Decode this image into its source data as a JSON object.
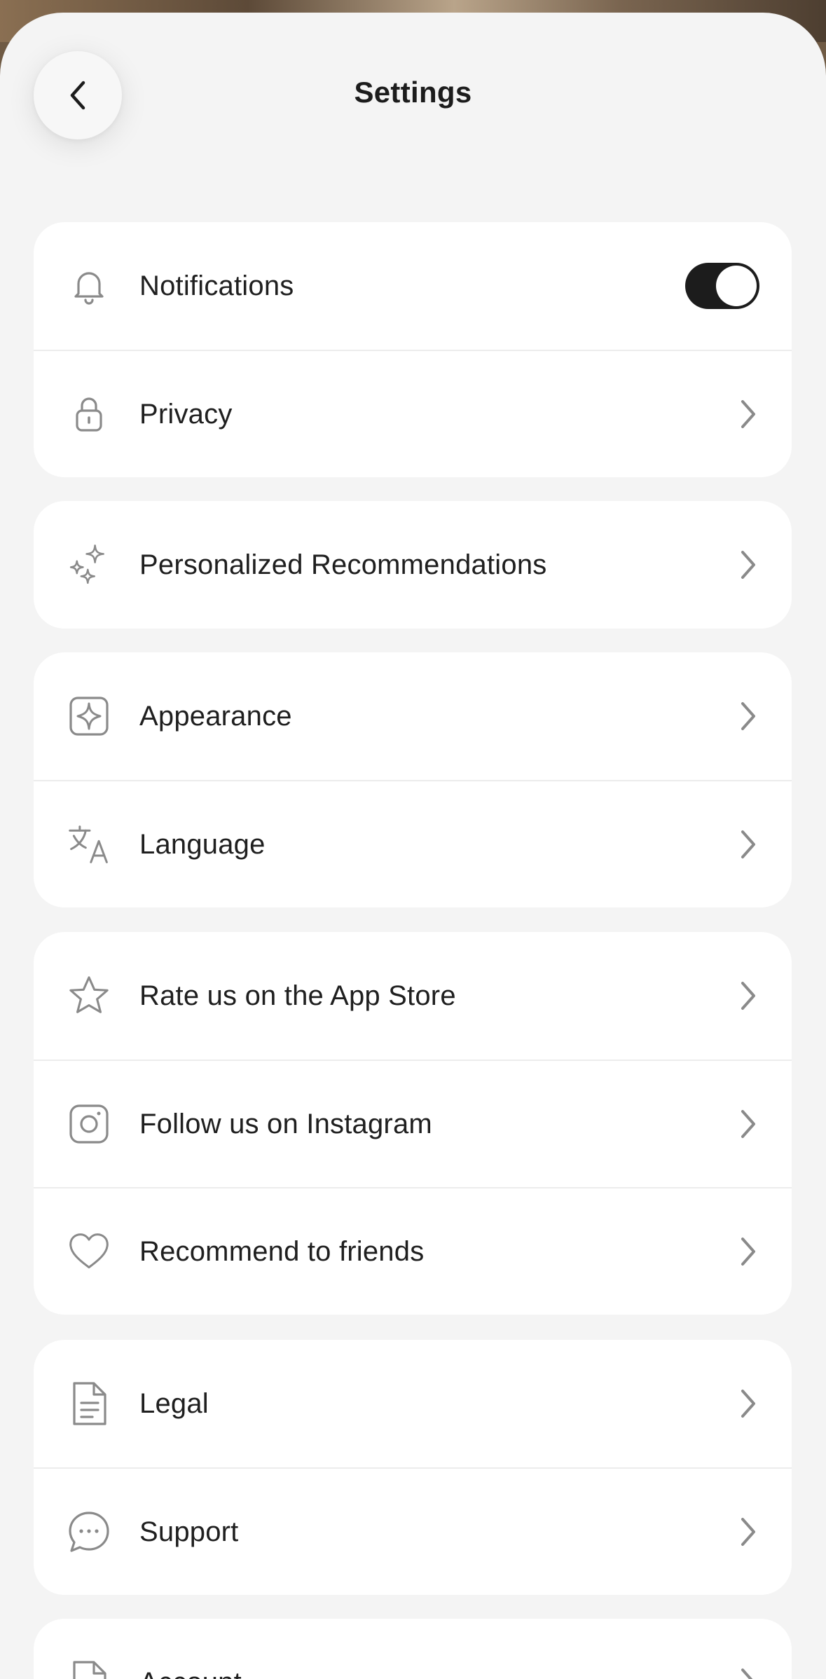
{
  "header": {
    "title": "Settings",
    "back_icon": "chevron-left-icon"
  },
  "groups": [
    {
      "items": [
        {
          "label": "Notifications",
          "icon": "bell-icon",
          "control": "toggle",
          "toggle_on": true
        },
        {
          "label": "Privacy",
          "icon": "lock-icon",
          "control": "chevron"
        }
      ]
    },
    {
      "items": [
        {
          "label": "Personalized Recommendations",
          "icon": "sparkles-icon",
          "control": "chevron"
        }
      ]
    },
    {
      "items": [
        {
          "label": "Appearance",
          "icon": "appearance-icon",
          "control": "chevron"
        },
        {
          "label": "Language",
          "icon": "translate-icon",
          "control": "chevron"
        }
      ]
    },
    {
      "items": [
        {
          "label": "Rate us on the App Store",
          "icon": "star-icon",
          "control": "chevron"
        },
        {
          "label": "Follow us on Instagram",
          "icon": "instagram-icon",
          "control": "chevron"
        },
        {
          "label": "Recommend to friends",
          "icon": "heart-icon",
          "control": "chevron"
        }
      ]
    },
    {
      "items": [
        {
          "label": "Legal",
          "icon": "document-icon",
          "control": "chevron"
        },
        {
          "label": "Support",
          "icon": "chat-bubble-icon",
          "control": "chevron"
        }
      ]
    },
    {
      "items": [
        {
          "label": "Account",
          "icon": "account-icon",
          "control": "chevron"
        }
      ]
    }
  ],
  "colors": {
    "background": "#f4f4f4",
    "card": "#ffffff",
    "text": "#1f1f1f",
    "icon": "#8a8a8a",
    "toggle_on": "#1c1c1c"
  }
}
